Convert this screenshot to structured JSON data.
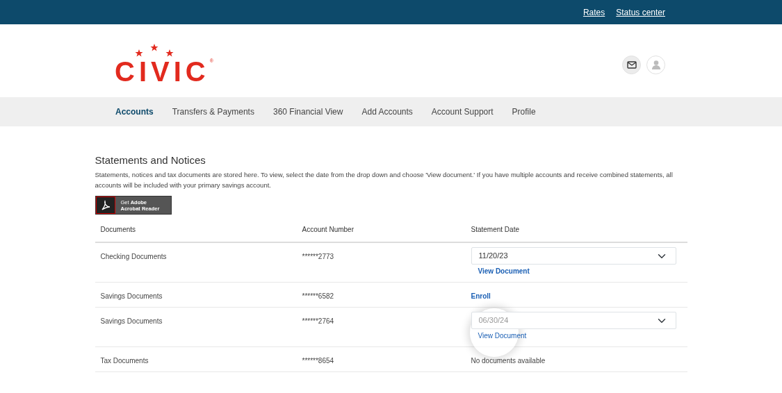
{
  "top_links": [
    "Rates",
    "Status center"
  ],
  "logo": {
    "text": "CIVIC",
    "mark": "®"
  },
  "nav": [
    {
      "label": "Accounts",
      "selected": true
    },
    {
      "label": "Transfers & Payments",
      "selected": false
    },
    {
      "label": "360 Financial View",
      "selected": false
    },
    {
      "label": "Add Accounts",
      "selected": false
    },
    {
      "label": "Account Support",
      "selected": false
    },
    {
      "label": "Profile",
      "selected": false
    }
  ],
  "page": {
    "title": "Statements and Notices",
    "description": "Statements, notices and tax documents are stored here. To view, select the date from the drop down and choose 'View document.' If you have multiple accounts and receive combined statements, all accounts will be included with your primary savings account."
  },
  "acrobat_badge": {
    "line_1_prefix": "Get",
    "line_1": "Adobe",
    "line_2": "Acrobat Reader"
  },
  "table": {
    "columns": [
      "Documents",
      "Account Number",
      "Statement Date"
    ],
    "rows": [
      {
        "document": "Checking Documents",
        "account": "******2773",
        "date": {
          "kind": "select",
          "value": "11/20/23",
          "link": "View Document"
        },
        "spotlight": false
      },
      {
        "document": "Savings Documents",
        "account": "******6582",
        "date": {
          "kind": "link",
          "link": "Enroll"
        },
        "spotlight": false
      },
      {
        "document": "Savings Documents",
        "account": "******2764",
        "date": {
          "kind": "select",
          "value": "06/30/24",
          "link": "View Document"
        },
        "spotlight": true
      },
      {
        "document": "Tax Documents",
        "account": "******8654",
        "date": {
          "kind": "text",
          "text": "No documents available"
        },
        "spotlight": false
      }
    ]
  }
}
